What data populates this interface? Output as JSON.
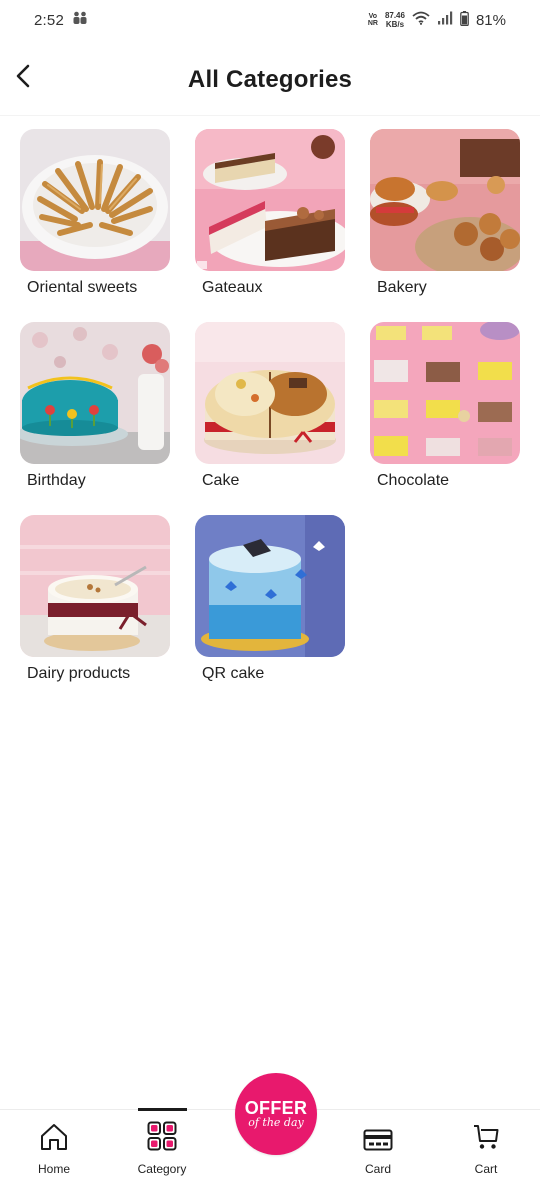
{
  "status_bar": {
    "time": "2:52",
    "network_top": "Vo",
    "network_bottom": "NR",
    "speed_value": "87.46",
    "speed_unit": "KB/s",
    "battery": "81%"
  },
  "header": {
    "title": "All Categories"
  },
  "categories": [
    {
      "label": "Oriental sweets",
      "icon": "oriental-sweets-image"
    },
    {
      "label": "Gateaux",
      "icon": "gateaux-image"
    },
    {
      "label": "Bakery",
      "icon": "bakery-image"
    },
    {
      "label": "Birthday",
      "icon": "birthday-image"
    },
    {
      "label": "Cake",
      "icon": "cake-image"
    },
    {
      "label": "Chocolate",
      "icon": "chocolate-image"
    },
    {
      "label": "Dairy products",
      "icon": "dairy-products-image"
    },
    {
      "label": "QR cake",
      "icon": "qr-cake-image"
    }
  ],
  "nav": {
    "home": "Home",
    "category": "Category",
    "card": "Card",
    "cart": "Cart",
    "active": "category",
    "offer_main": "OFFER",
    "offer_sub": "of the day"
  },
  "colors": {
    "accent": "#e8196d",
    "text": "#1b1b1b"
  }
}
